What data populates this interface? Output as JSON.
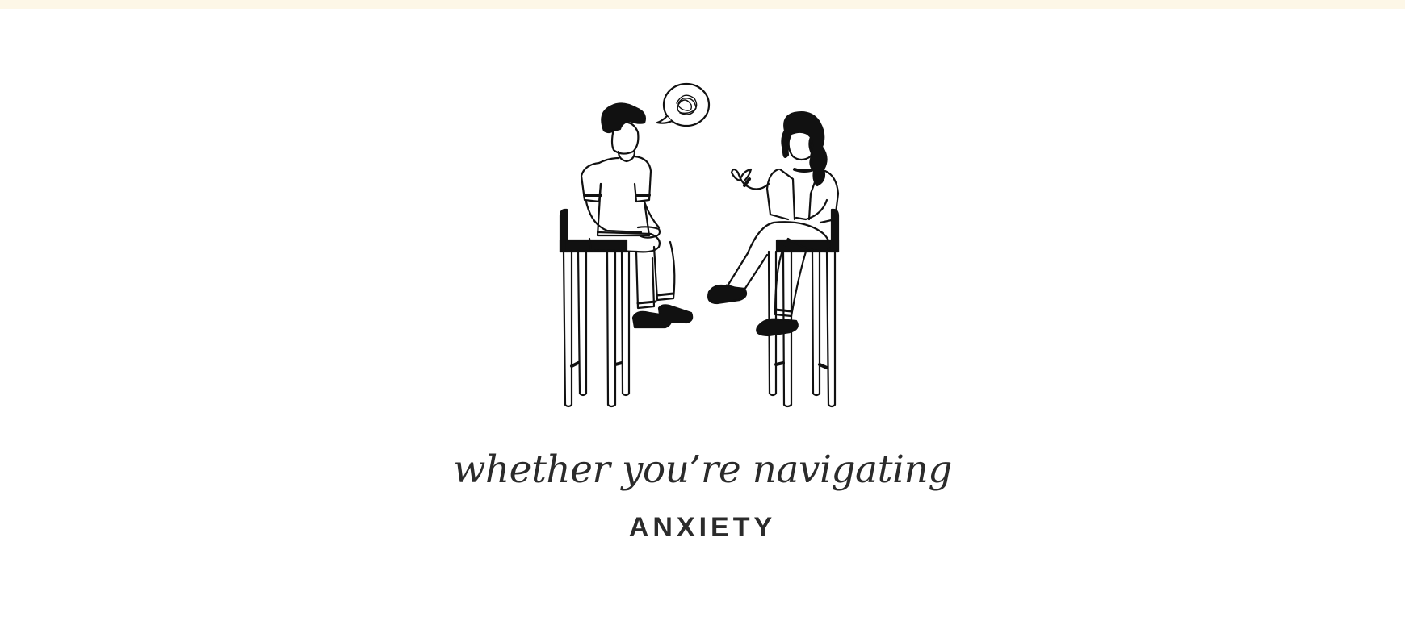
{
  "colors": {
    "top_strip": "#fdf7e7",
    "ink": "#111111",
    "text": "#2b2b2b",
    "background": "#ffffff"
  },
  "hero": {
    "headline": "whether you’re navigating",
    "topic": "ANXIETY"
  },
  "illustration": {
    "icon": "therapy-session-illustration"
  }
}
